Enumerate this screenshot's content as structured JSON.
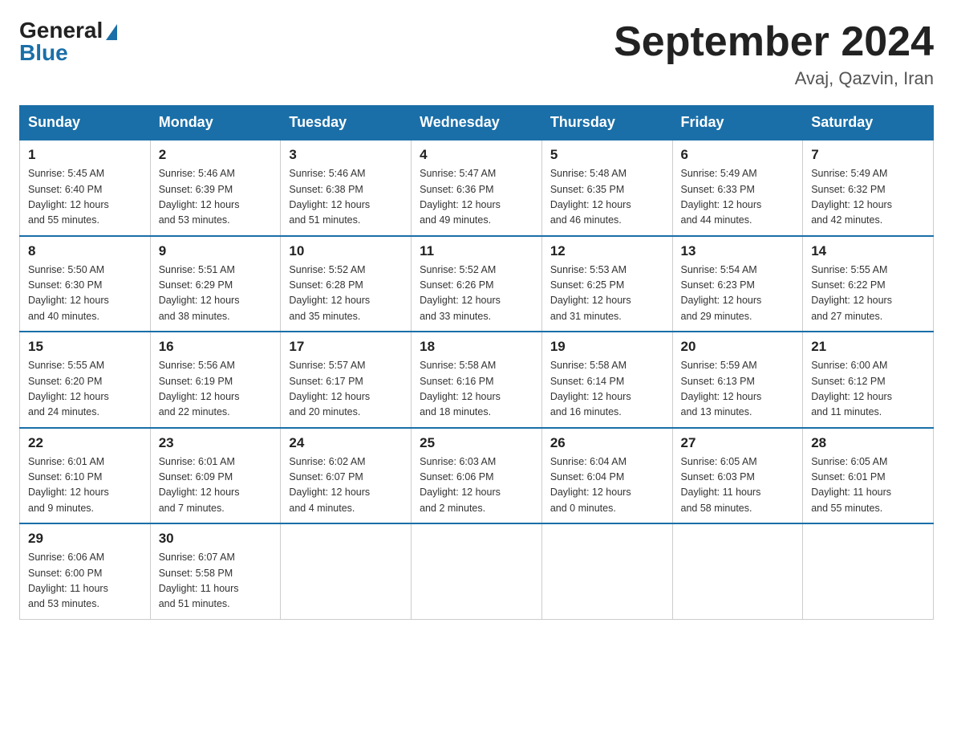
{
  "header": {
    "logo_general": "General",
    "logo_blue": "Blue",
    "month_title": "September 2024",
    "location": "Avaj, Qazvin, Iran"
  },
  "days_of_week": [
    "Sunday",
    "Monday",
    "Tuesday",
    "Wednesday",
    "Thursday",
    "Friday",
    "Saturday"
  ],
  "weeks": [
    [
      {
        "day": "1",
        "info": "Sunrise: 5:45 AM\nSunset: 6:40 PM\nDaylight: 12 hours\nand 55 minutes."
      },
      {
        "day": "2",
        "info": "Sunrise: 5:46 AM\nSunset: 6:39 PM\nDaylight: 12 hours\nand 53 minutes."
      },
      {
        "day": "3",
        "info": "Sunrise: 5:46 AM\nSunset: 6:38 PM\nDaylight: 12 hours\nand 51 minutes."
      },
      {
        "day": "4",
        "info": "Sunrise: 5:47 AM\nSunset: 6:36 PM\nDaylight: 12 hours\nand 49 minutes."
      },
      {
        "day": "5",
        "info": "Sunrise: 5:48 AM\nSunset: 6:35 PM\nDaylight: 12 hours\nand 46 minutes."
      },
      {
        "day": "6",
        "info": "Sunrise: 5:49 AM\nSunset: 6:33 PM\nDaylight: 12 hours\nand 44 minutes."
      },
      {
        "day": "7",
        "info": "Sunrise: 5:49 AM\nSunset: 6:32 PM\nDaylight: 12 hours\nand 42 minutes."
      }
    ],
    [
      {
        "day": "8",
        "info": "Sunrise: 5:50 AM\nSunset: 6:30 PM\nDaylight: 12 hours\nand 40 minutes."
      },
      {
        "day": "9",
        "info": "Sunrise: 5:51 AM\nSunset: 6:29 PM\nDaylight: 12 hours\nand 38 minutes."
      },
      {
        "day": "10",
        "info": "Sunrise: 5:52 AM\nSunset: 6:28 PM\nDaylight: 12 hours\nand 35 minutes."
      },
      {
        "day": "11",
        "info": "Sunrise: 5:52 AM\nSunset: 6:26 PM\nDaylight: 12 hours\nand 33 minutes."
      },
      {
        "day": "12",
        "info": "Sunrise: 5:53 AM\nSunset: 6:25 PM\nDaylight: 12 hours\nand 31 minutes."
      },
      {
        "day": "13",
        "info": "Sunrise: 5:54 AM\nSunset: 6:23 PM\nDaylight: 12 hours\nand 29 minutes."
      },
      {
        "day": "14",
        "info": "Sunrise: 5:55 AM\nSunset: 6:22 PM\nDaylight: 12 hours\nand 27 minutes."
      }
    ],
    [
      {
        "day": "15",
        "info": "Sunrise: 5:55 AM\nSunset: 6:20 PM\nDaylight: 12 hours\nand 24 minutes."
      },
      {
        "day": "16",
        "info": "Sunrise: 5:56 AM\nSunset: 6:19 PM\nDaylight: 12 hours\nand 22 minutes."
      },
      {
        "day": "17",
        "info": "Sunrise: 5:57 AM\nSunset: 6:17 PM\nDaylight: 12 hours\nand 20 minutes."
      },
      {
        "day": "18",
        "info": "Sunrise: 5:58 AM\nSunset: 6:16 PM\nDaylight: 12 hours\nand 18 minutes."
      },
      {
        "day": "19",
        "info": "Sunrise: 5:58 AM\nSunset: 6:14 PM\nDaylight: 12 hours\nand 16 minutes."
      },
      {
        "day": "20",
        "info": "Sunrise: 5:59 AM\nSunset: 6:13 PM\nDaylight: 12 hours\nand 13 minutes."
      },
      {
        "day": "21",
        "info": "Sunrise: 6:00 AM\nSunset: 6:12 PM\nDaylight: 12 hours\nand 11 minutes."
      }
    ],
    [
      {
        "day": "22",
        "info": "Sunrise: 6:01 AM\nSunset: 6:10 PM\nDaylight: 12 hours\nand 9 minutes."
      },
      {
        "day": "23",
        "info": "Sunrise: 6:01 AM\nSunset: 6:09 PM\nDaylight: 12 hours\nand 7 minutes."
      },
      {
        "day": "24",
        "info": "Sunrise: 6:02 AM\nSunset: 6:07 PM\nDaylight: 12 hours\nand 4 minutes."
      },
      {
        "day": "25",
        "info": "Sunrise: 6:03 AM\nSunset: 6:06 PM\nDaylight: 12 hours\nand 2 minutes."
      },
      {
        "day": "26",
        "info": "Sunrise: 6:04 AM\nSunset: 6:04 PM\nDaylight: 12 hours\nand 0 minutes."
      },
      {
        "day": "27",
        "info": "Sunrise: 6:05 AM\nSunset: 6:03 PM\nDaylight: 11 hours\nand 58 minutes."
      },
      {
        "day": "28",
        "info": "Sunrise: 6:05 AM\nSunset: 6:01 PM\nDaylight: 11 hours\nand 55 minutes."
      }
    ],
    [
      {
        "day": "29",
        "info": "Sunrise: 6:06 AM\nSunset: 6:00 PM\nDaylight: 11 hours\nand 53 minutes."
      },
      {
        "day": "30",
        "info": "Sunrise: 6:07 AM\nSunset: 5:58 PM\nDaylight: 11 hours\nand 51 minutes."
      },
      {
        "day": "",
        "info": ""
      },
      {
        "day": "",
        "info": ""
      },
      {
        "day": "",
        "info": ""
      },
      {
        "day": "",
        "info": ""
      },
      {
        "day": "",
        "info": ""
      }
    ]
  ]
}
